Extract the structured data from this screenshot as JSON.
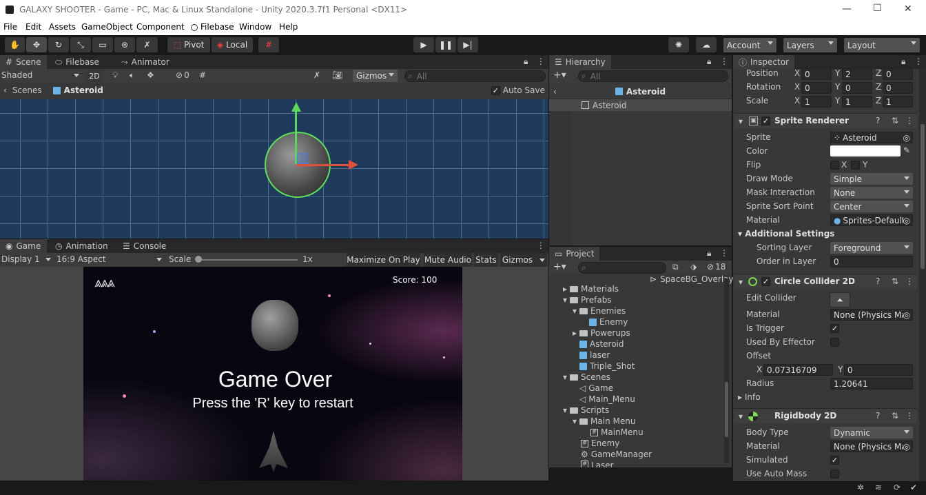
{
  "window": {
    "title": "GALAXY SHOOTER - Game - PC, Mac & Linux Standalone - Unity 2020.3.7f1 Personal <DX11>",
    "min": "—",
    "max": "☐",
    "close": "✕"
  },
  "menu": [
    "File",
    "Edit",
    "Assets",
    "GameObject",
    "Component",
    "Filebase",
    "Window",
    "Help"
  ],
  "toolbar": {
    "pivot": "Pivot",
    "local": "Local",
    "account": "Account",
    "layers": "Layers",
    "layout": "Layout"
  },
  "scene": {
    "tabs": [
      "Scene",
      "Filebase",
      "Animator"
    ],
    "shading": "Shaded",
    "mode2d": "2D",
    "hidden_count": "0",
    "gizmos": "Gizmos",
    "search_placeholder": "All",
    "breadcrumb_root": "Scenes",
    "breadcrumb_item": "Asteroid",
    "auto_save": "Auto Save"
  },
  "game": {
    "tabs": [
      "Game",
      "Animation",
      "Console"
    ],
    "display": "Display 1",
    "aspect": "16:9 Aspect",
    "scale_label": "Scale",
    "scale_value": "1x",
    "maximize": "Maximize On Play",
    "mute": "Mute Audio",
    "stats": "Stats",
    "gizmos": "Gizmos",
    "score": "Score: 100",
    "game_over": "Game Over",
    "restart_hint": "Press the 'R' key to restart"
  },
  "hierarchy": {
    "tab": "Hierarchy",
    "search_placeholder": "All",
    "header": "Asteroid",
    "item": "Asteroid"
  },
  "project": {
    "tab": "Project",
    "hidden_count": "18",
    "overlay_item": "SpaceBG_Overlay",
    "items": [
      {
        "label": "Materials",
        "type": "folder"
      },
      {
        "label": "Prefabs",
        "type": "folder"
      },
      {
        "label": "Enemies",
        "type": "folder"
      },
      {
        "label": "Enemy",
        "type": "prefab"
      },
      {
        "label": "Powerups",
        "type": "folder"
      },
      {
        "label": "Asteroid",
        "type": "prefab"
      },
      {
        "label": "laser",
        "type": "prefab"
      },
      {
        "label": "Triple_Shot",
        "type": "prefab"
      },
      {
        "label": "Scenes",
        "type": "folder"
      },
      {
        "label": "Game",
        "type": "scene"
      },
      {
        "label": "Main_Menu",
        "type": "scene"
      },
      {
        "label": "Scripts",
        "type": "folder"
      },
      {
        "label": "Main Menu",
        "type": "folder"
      },
      {
        "label": "MainMenu",
        "type": "script"
      },
      {
        "label": "Enemy",
        "type": "script"
      },
      {
        "label": "GameManager",
        "type": "script"
      },
      {
        "label": "Laser",
        "type": "script"
      }
    ]
  },
  "inspector": {
    "tab": "Inspector",
    "transform": [
      {
        "label": "Position",
        "x": "0",
        "y": "2",
        "z": "0"
      },
      {
        "label": "Rotation",
        "x": "0",
        "y": "0",
        "z": "0"
      },
      {
        "label": "Scale",
        "x": "1",
        "y": "1",
        "z": "1"
      }
    ],
    "axis": {
      "x": "X",
      "y": "Y",
      "z": "Z"
    },
    "sprite_renderer": {
      "title": "Sprite Renderer",
      "sprite_label": "Sprite",
      "sprite": "Asteroid",
      "color_label": "Color",
      "flip_label": "Flip",
      "flip_x": "X",
      "flip_y": "Y",
      "draw_mode_label": "Draw Mode",
      "draw_mode": "Simple",
      "mask_label": "Mask Interaction",
      "mask": "None",
      "sort_point_label": "Sprite Sort Point",
      "sort_point": "Center",
      "material_label": "Material",
      "material": "Sprites-Default",
      "additional": "Additional Settings",
      "sorting_layer_label": "Sorting Layer",
      "sorting_layer": "Foreground",
      "order_label": "Order in Layer",
      "order": "0"
    },
    "circle_collider": {
      "title": "Circle Collider 2D",
      "edit_label": "Edit Collider",
      "material_label": "Material",
      "material": "None (Physics Ma",
      "trigger_label": "Is Trigger",
      "effector_label": "Used By Effector",
      "offset_label": "Offset",
      "offset_x": "0.07316709",
      "offset_y": "0",
      "radius_label": "Radius",
      "radius": "1.20641",
      "info": "Info"
    },
    "rigidbody": {
      "title": "Rigidbody 2D",
      "body_type_label": "Body Type",
      "body_type": "Dynamic",
      "material_label": "Material",
      "material": "None (Physics Ma",
      "simulated_label": "Simulated",
      "auto_mass_label": "Use Auto Mass"
    }
  }
}
